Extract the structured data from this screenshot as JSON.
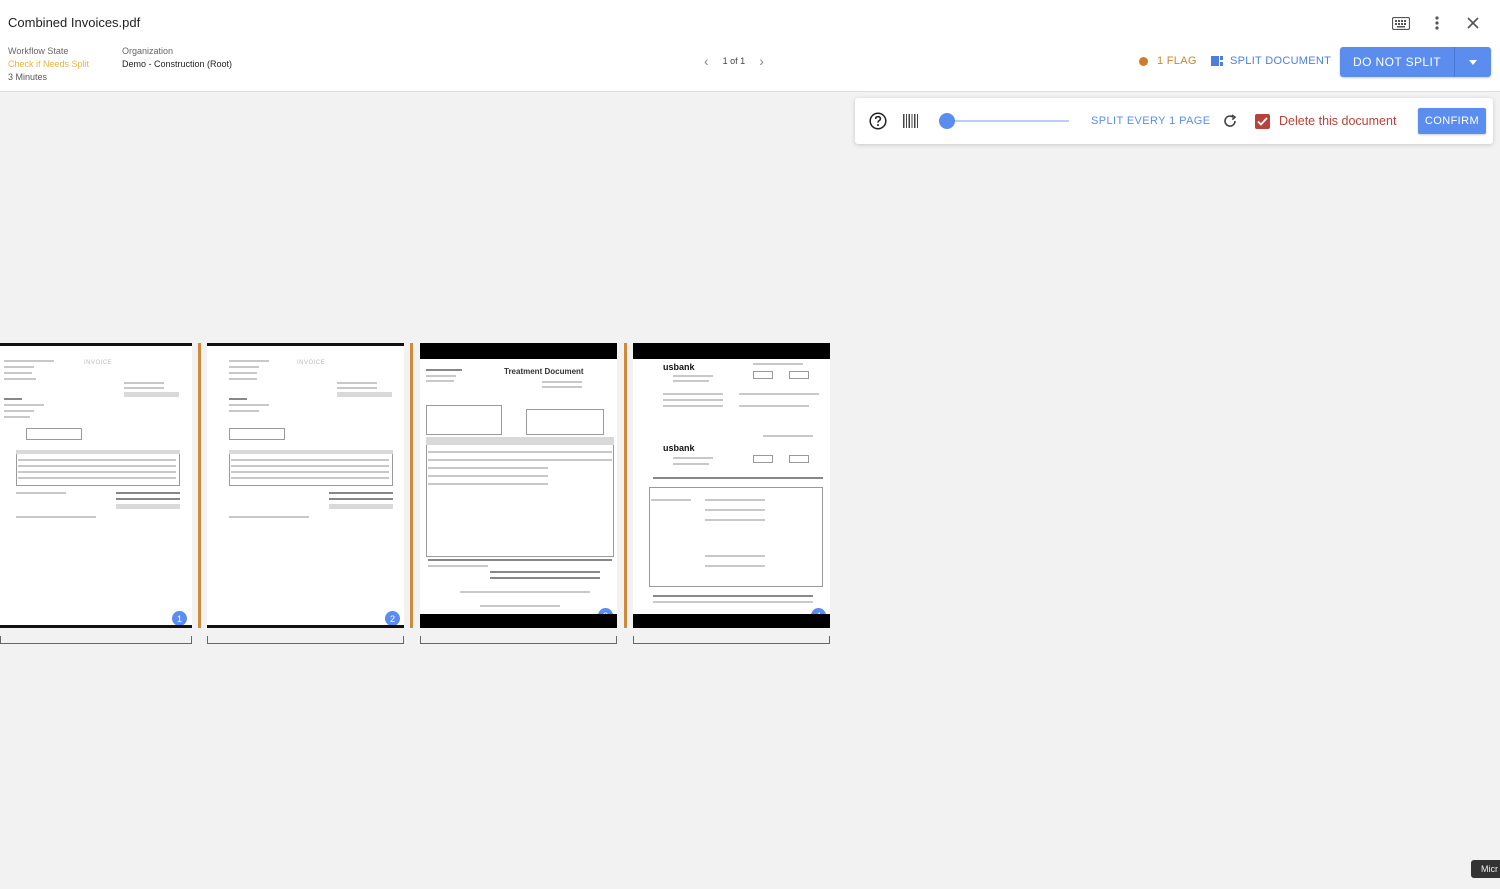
{
  "header": {
    "title": "Combined Invoices.pdf",
    "workflow_state_label": "Workflow State",
    "workflow_state_value": "Check if Needs Split",
    "workflow_state_time": "3 Minutes",
    "organization_label": "Organization",
    "organization_value": "Demo - Construction (Root)",
    "pager_text": "1 of 1",
    "flag_label": "1 FLAG",
    "split_document_label": "SPLIT DOCUMENT",
    "do_not_split_label": "DO NOT SPLIT",
    "icons": [
      "keyboard-icon",
      "more-vert-icon",
      "close-icon"
    ],
    "colors": {
      "accent": "#5b8def",
      "flag": "#cf7a2c",
      "state": "#e0b64a",
      "danger": "#b8433a"
    }
  },
  "toolbar": {
    "icons": [
      "help-icon",
      "barcode-icon",
      "refresh-icon"
    ],
    "slider_value": 1,
    "split_every_label": "SPLIT EVERY 1 PAGE",
    "delete_checked": true,
    "delete_label": "Delete this document",
    "confirm_label": "CONFIRM"
  },
  "pages": [
    {
      "number": "1",
      "kind": "invoice",
      "heading": "INVOICE"
    },
    {
      "number": "2",
      "kind": "invoice",
      "heading": "INVOICE"
    },
    {
      "number": "3",
      "kind": "treatment",
      "heading": "Treatment Document"
    },
    {
      "number": "4",
      "kind": "bank",
      "heading": "usbank"
    }
  ],
  "footer": {
    "corner_text": "Micr"
  }
}
